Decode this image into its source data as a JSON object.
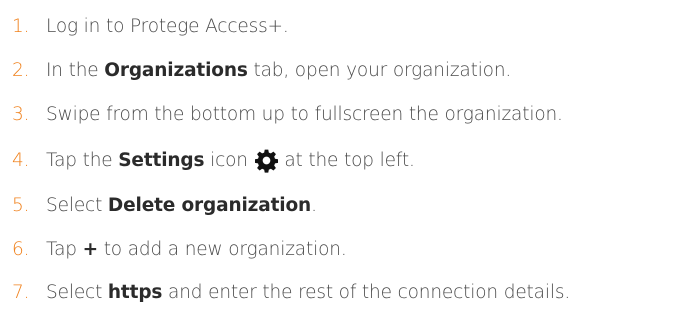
{
  "steps": [
    {
      "number": "1.",
      "parts": [
        "Log in to Protege Access+."
      ]
    },
    {
      "number": "2.",
      "parts": [
        "In the ",
        "Organizations",
        " tab, open your organization."
      ]
    },
    {
      "number": "3.",
      "parts": [
        "Swipe from the bottom up to fullscreen the organization."
      ]
    },
    {
      "number": "4.",
      "parts": [
        "Tap the ",
        "Settings",
        " icon ",
        " at the top left."
      ]
    },
    {
      "number": "5.",
      "parts": [
        "Select ",
        "Delete organization",
        "."
      ]
    },
    {
      "number": "6.",
      "parts": [
        "Tap ",
        "+",
        " to add a new organization."
      ]
    },
    {
      "number": "7.",
      "parts": [
        "Select ",
        "https",
        " and enter the rest of the connection details."
      ]
    }
  ],
  "icons": {
    "settings": "gear-icon"
  },
  "colors": {
    "number": "#f0821e",
    "text": "#4a4a4a",
    "bold": "#2b2b2b"
  }
}
